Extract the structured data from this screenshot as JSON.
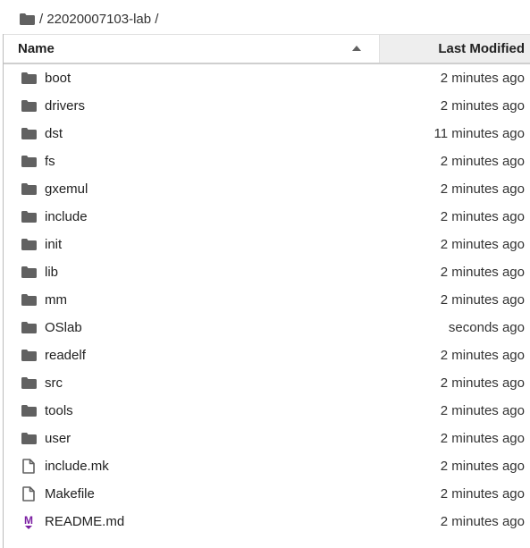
{
  "breadcrumb": {
    "path": "/ 22020007103-lab /"
  },
  "header": {
    "name": "Name",
    "modified": "Last Modified"
  },
  "files": [
    {
      "name": "boot",
      "type": "folder",
      "modified": "2 minutes ago"
    },
    {
      "name": "drivers",
      "type": "folder",
      "modified": "2 minutes ago"
    },
    {
      "name": "dst",
      "type": "folder",
      "modified": "11 minutes ago"
    },
    {
      "name": "fs",
      "type": "folder",
      "modified": "2 minutes ago"
    },
    {
      "name": "gxemul",
      "type": "folder",
      "modified": "2 minutes ago"
    },
    {
      "name": "include",
      "type": "folder",
      "modified": "2 minutes ago"
    },
    {
      "name": "init",
      "type": "folder",
      "modified": "2 minutes ago"
    },
    {
      "name": "lib",
      "type": "folder",
      "modified": "2 minutes ago"
    },
    {
      "name": "mm",
      "type": "folder",
      "modified": "2 minutes ago"
    },
    {
      "name": "OSlab",
      "type": "folder",
      "modified": "seconds ago"
    },
    {
      "name": "readelf",
      "type": "folder",
      "modified": "2 minutes ago"
    },
    {
      "name": "src",
      "type": "folder",
      "modified": "2 minutes ago"
    },
    {
      "name": "tools",
      "type": "folder",
      "modified": "2 minutes ago"
    },
    {
      "name": "user",
      "type": "folder",
      "modified": "2 minutes ago"
    },
    {
      "name": "include.mk",
      "type": "file",
      "modified": "2 minutes ago"
    },
    {
      "name": "Makefile",
      "type": "file",
      "modified": "2 minutes ago"
    },
    {
      "name": "README.md",
      "type": "markdown",
      "modified": "2 minutes ago"
    }
  ],
  "colors": {
    "folder": "#616161",
    "markdown": "#7b1fa2"
  }
}
